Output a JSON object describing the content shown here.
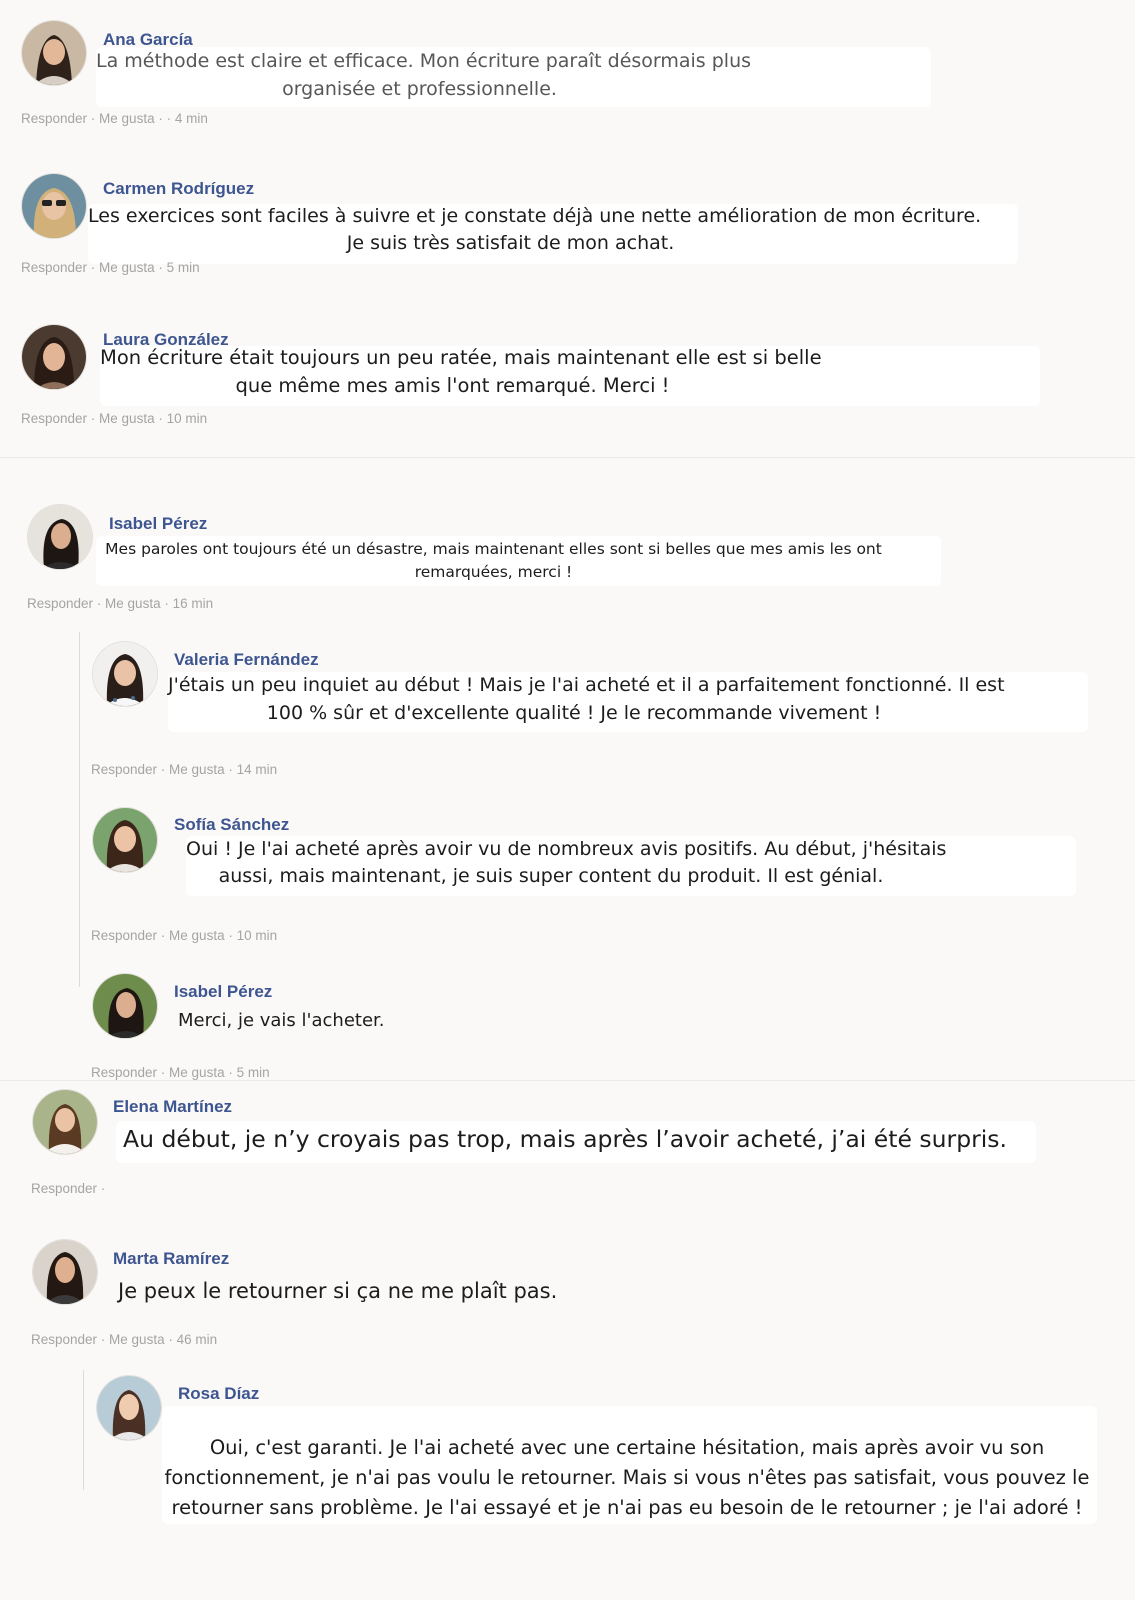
{
  "actions": {
    "reply": "Responder",
    "like": "Me gusta",
    "sep": " · "
  },
  "comments": [
    {
      "name": "Ana García",
      "lines": [
        "La méthode est claire et efficace. Mon écriture paraît désormais plus",
        "organisée et professionnelle."
      ],
      "time": "· 4 min"
    },
    {
      "name": "Carmen Rodríguez",
      "lines": [
        "Les exercices sont faciles à suivre et je constate déjà une nette amélioration de mon écriture.",
        "Je suis très satisfait de mon achat."
      ],
      "time": "5 min"
    },
    {
      "name": "Laura González",
      "lines": [
        "Mon écriture était toujours un peu ratée, mais maintenant elle est si belle",
        "que même mes amis l'ont remarqué. Merci !"
      ],
      "time": "10 min"
    },
    {
      "name": "Isabel Pérez",
      "lines": [
        "Mes paroles ont toujours été un désastre, mais maintenant elles sont si belles que mes amis les ont",
        "remarquées, merci !"
      ],
      "time": "16 min"
    },
    {
      "name": "Valeria Fernández",
      "lines": [
        "J'étais un peu inquiet au début ! Mais je l'ai acheté et il a parfaitement fonctionné. Il est",
        "100 % sûr et d'excellente qualité ! Je le recommande vivement !"
      ],
      "time": "14 min"
    },
    {
      "name": "Sofía Sánchez",
      "lines": [
        "Oui ! Je l'ai acheté après avoir vu de nombreux avis positifs. Au début, j'hésitais",
        "aussi, mais maintenant, je suis super content du produit. Il est génial."
      ],
      "time": "10 min"
    },
    {
      "name": "Isabel Pérez",
      "lines": [
        "Merci, je vais l'acheter."
      ],
      "time": "5 min"
    },
    {
      "name": "Elena Martínez",
      "lines": [
        "Au début, je n’y croyais pas trop, mais après l’avoir acheté, j’ai été surpris."
      ],
      "time": ""
    },
    {
      "name": "Marta Ramírez",
      "lines": [
        "Je peux le retourner si ça ne me plaît pas."
      ],
      "time": "46 min"
    },
    {
      "name": "Rosa Díaz",
      "lines": [
        "Oui, c'est garanti. Je l'ai acheté avec une certaine hésitation, mais après avoir vu son",
        "fonctionnement, je n'ai pas voulu le retourner. Mais si vous n'êtes pas satisfait, vous pouvez le",
        "retourner sans problème. Je l'ai essayé et je n'ai pas eu besoin de le retourner ; je l'ai adoré !"
      ],
      "time": ""
    }
  ],
  "colors": {
    "name": "#3d5590",
    "meta": "#a4a4a4",
    "text": "#1c1c1c",
    "background": "#fbf9f7"
  }
}
